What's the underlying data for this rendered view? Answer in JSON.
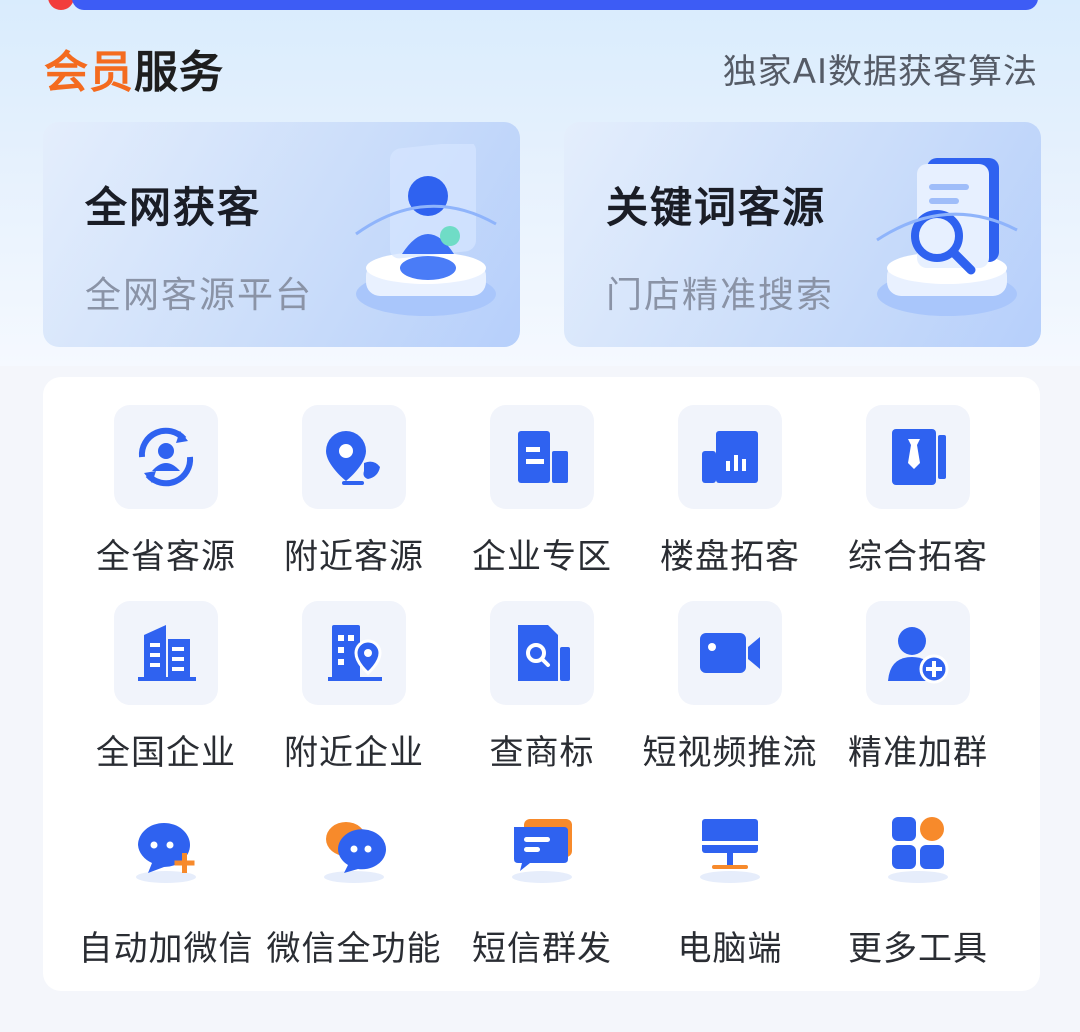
{
  "header": {
    "title_accent": "会员",
    "title_rest": "服务",
    "slogan": "独家AI数据获客算法"
  },
  "feature_cards": [
    {
      "title": "全网获客",
      "subtitle": "全网客源平台",
      "icon": "person-hologram-illustration"
    },
    {
      "title": "关键词客源",
      "subtitle": "门店精准搜索",
      "icon": "search-document-illustration"
    }
  ],
  "tools": {
    "row1": [
      {
        "label": "全省客源",
        "icon": "refresh-person-icon"
      },
      {
        "label": "附近客源",
        "icon": "location-phone-icon"
      },
      {
        "label": "企业专区",
        "icon": "building-icon"
      },
      {
        "label": "楼盘拓客",
        "icon": "chart-building-icon"
      },
      {
        "label": "综合拓客",
        "icon": "tie-book-icon"
      }
    ],
    "row2": [
      {
        "label": "全国企业",
        "icon": "office-building-icon"
      },
      {
        "label": "附近企业",
        "icon": "building-location-icon"
      },
      {
        "label": "查商标",
        "icon": "search-file-icon"
      },
      {
        "label": "短视频推流",
        "icon": "video-camera-icon"
      },
      {
        "label": "精准加群",
        "icon": "add-user-icon"
      }
    ],
    "row3": [
      {
        "label": "自动加微信",
        "icon": "chat-add-icon"
      },
      {
        "label": "微信全功能",
        "icon": "double-chat-icon"
      },
      {
        "label": "短信群发",
        "icon": "message-icon"
      },
      {
        "label": "电脑端",
        "icon": "monitor-icon"
      },
      {
        "label": "更多工具",
        "icon": "grid-apps-icon"
      }
    ]
  },
  "colors": {
    "accent_orange": "#f46b1f",
    "primary_blue": "#2f62f0",
    "icon_bg": "#f1f4fb"
  }
}
